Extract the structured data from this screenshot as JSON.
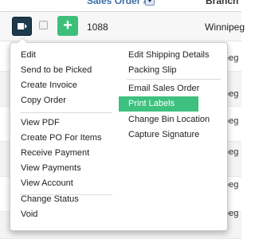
{
  "header": {
    "sales_order_label": "Sales Order #",
    "branch_label": "Branch"
  },
  "row": {
    "order_number": "1088",
    "branch": "Winnipeg"
  },
  "other_rows_branch": "peg",
  "menu": {
    "left_groups": [
      [
        "Edit",
        "Send to be Picked",
        "Create Invoice",
        "Copy Order"
      ],
      [
        "View PDF",
        "Create PO For Items",
        "Receive Payment",
        "View Payments",
        "View Account"
      ],
      [
        "Change Status",
        "Void"
      ]
    ],
    "right_groups": [
      [
        "Edit Shipping Details",
        "Packing Slip"
      ],
      [
        "Email Sales Order",
        "Print Labels",
        "Change Bin Location",
        "Capture Signature"
      ]
    ],
    "active_item": "Print Labels"
  },
  "colors": {
    "accent_green": "#3ec07f",
    "action_button": "#1f3a4c",
    "header_link": "#3a6ea5"
  }
}
